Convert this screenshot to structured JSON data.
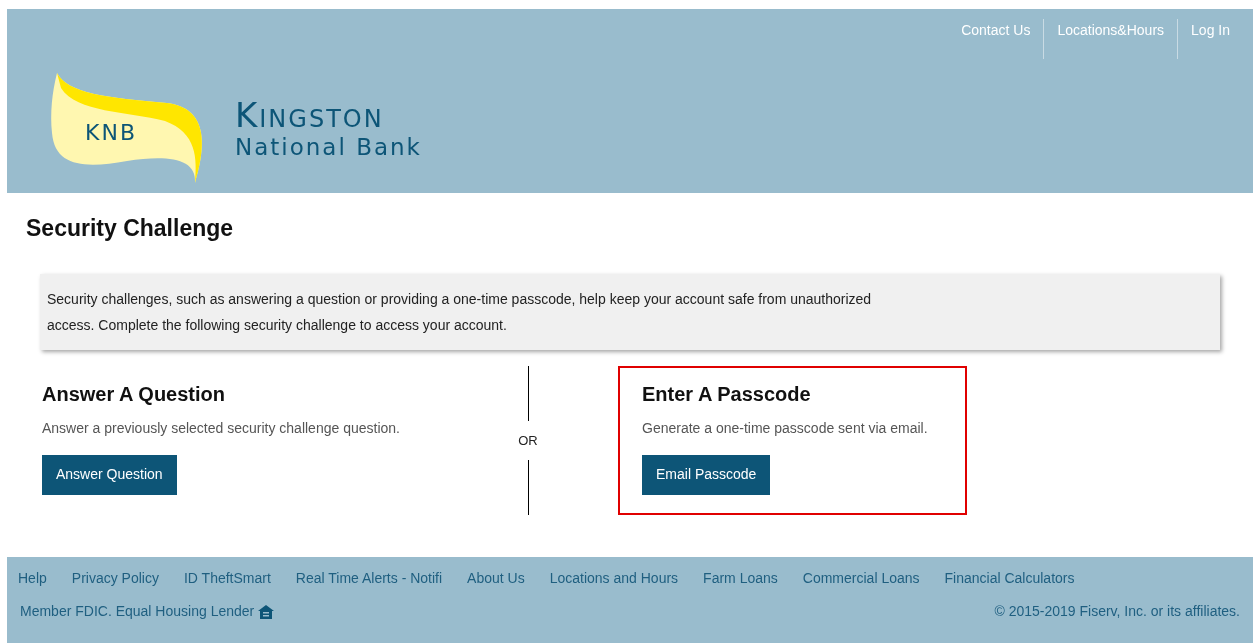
{
  "top_nav": [
    "Contact Us",
    "Locations&Hours",
    "Log In"
  ],
  "logo": {
    "monogram": "KNB",
    "name": "Kingston",
    "subtitle": "National Bank"
  },
  "page_title": "Security Challenge",
  "intro": "Security challenges, such as answering a question or providing a one-time passcode, help keep your account safe from unauthorized access. Complete the following security challenge to access your account.",
  "options": [
    {
      "title": "Answer A Question",
      "description": "Answer a previously selected security challenge question.",
      "button": "Answer Question",
      "highlighted": false
    },
    {
      "title": "Enter A Passcode",
      "description": "Generate a one-time passcode sent via email.",
      "button": "Email Passcode",
      "highlighted": true
    }
  ],
  "divider_label": "OR",
  "footer": {
    "links": [
      "Help",
      "Privacy Policy",
      "ID TheftSmart",
      "Real Time Alerts - Notifi",
      "About Us",
      "Locations and Hours",
      "Farm Loans",
      "Commercial Loans",
      "Financial Calculators"
    ],
    "member": "Member FDIC. Equal Housing Lender",
    "copyright": "© 2015-2019 Fiserv, Inc. or its affiliates."
  }
}
